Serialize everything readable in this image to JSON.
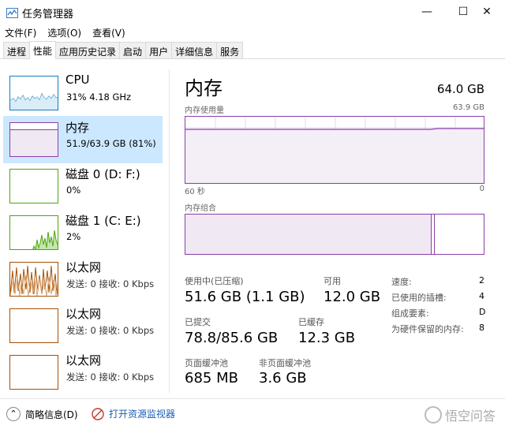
{
  "window": {
    "title": "任务管理器",
    "controls": {
      "minimize": "—",
      "maximize": "☐",
      "close": "✕"
    }
  },
  "menu": [
    "文件(F)",
    "选项(O)",
    "查看(V)"
  ],
  "tabs": [
    {
      "label": "进程",
      "active": false
    },
    {
      "label": "性能",
      "active": true
    },
    {
      "label": "应用历史记录",
      "active": false
    },
    {
      "label": "启动",
      "active": false
    },
    {
      "label": "用户",
      "active": false
    },
    {
      "label": "详细信息",
      "active": false
    },
    {
      "label": "服务",
      "active": false
    }
  ],
  "sidebar": {
    "items": [
      {
        "title": "CPU",
        "sub": "31% 4.18 GHz",
        "color": "#117dbb"
      },
      {
        "title": "内存",
        "sub": "51.9/63.9 GB (81%)",
        "color": "#8b3fa8",
        "selected": true,
        "fill": 0.81
      },
      {
        "title": "磁盘 0 (D: F:)",
        "sub": "0%",
        "color": "#4da60c"
      },
      {
        "title": "磁盘 1 (C: E:)",
        "sub": "2%",
        "color": "#4da60c"
      },
      {
        "title": "以太网",
        "sub": "发送: 0 接收: 0 Kbps",
        "color": "#a74f01"
      },
      {
        "title": "以太网",
        "sub": "发送: 0 接收: 0 Kbps",
        "color": "#a74f01"
      },
      {
        "title": "以太网",
        "sub": "发送: 0 接收: 0 Kbps",
        "color": "#a74f01"
      }
    ]
  },
  "main": {
    "title": "内存",
    "total": "64.0 GB",
    "usage_label": "内存使用量",
    "usage_max": "63.9 GB",
    "axis_left": "60 秒",
    "axis_right": "0",
    "composition_label": "内存组合",
    "usage_fraction": 0.81,
    "composition_used_fraction": 0.82,
    "stats": {
      "in_use_label": "使用中(已压缩)",
      "in_use_value": "51.6 GB (1.1 GB)",
      "available_label": "可用",
      "available_value": "12.0 GB",
      "committed_label": "已提交",
      "committed_value": "78.8/85.6 GB",
      "cached_label": "已缓存",
      "cached_value": "12.3 GB",
      "paged_label": "页面缓冲池",
      "paged_value": "685 MB",
      "nonpaged_label": "非页面缓冲池",
      "nonpaged_value": "3.6 GB"
    },
    "details": [
      {
        "label": "速度:",
        "value": "2"
      },
      {
        "label": "已使用的插槽:",
        "value": "4"
      },
      {
        "label": "组成要素:",
        "value": "D"
      },
      {
        "label": "为硬件保留的内存:",
        "value": "8"
      }
    ]
  },
  "footer": {
    "summary_label": "简略信息(D)",
    "monitor_label": "打开资源监视器",
    "watermark": "悟空问答"
  },
  "colors": {
    "memory": "#8b3fa8",
    "cpu": "#117dbb",
    "disk": "#4da60c",
    "ethernet": "#a74f01",
    "selected": "#cce8ff"
  }
}
